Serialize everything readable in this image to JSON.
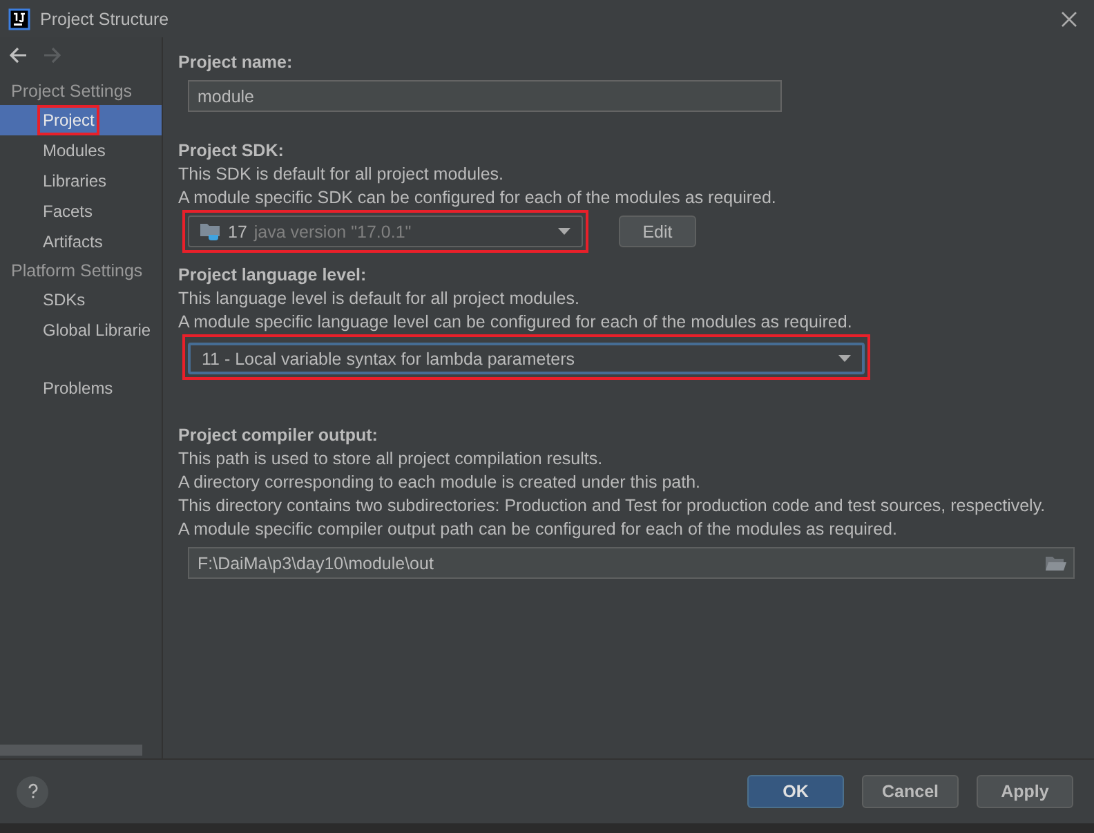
{
  "window": {
    "title": "Project Structure"
  },
  "navigation": [
    {
      "kind": "back",
      "disabled": false
    },
    {
      "kind": "forward",
      "disabled": true
    }
  ],
  "sidebar": {
    "groups": [
      {
        "title": "Project Settings",
        "items": [
          {
            "label": "Project",
            "selected": true,
            "highlighted": true
          },
          {
            "label": "Modules",
            "selected": false,
            "highlighted": false
          },
          {
            "label": "Libraries",
            "selected": false,
            "highlighted": false
          },
          {
            "label": "Facets",
            "selected": false,
            "highlighted": false
          },
          {
            "label": "Artifacts",
            "selected": false,
            "highlighted": false
          }
        ]
      },
      {
        "title": "Platform Settings",
        "items": [
          {
            "label": "SDKs",
            "selected": false,
            "highlighted": false
          },
          {
            "label": "Global Librarie",
            "selected": false,
            "highlighted": false
          }
        ]
      },
      {
        "items": [
          {
            "label": "Problems",
            "selected": false,
            "highlighted": false
          }
        ]
      }
    ]
  },
  "sections": [
    {
      "kind": "text",
      "label": "Project name:",
      "value": "module"
    },
    {
      "kind": "sdk",
      "label": "Project SDK:",
      "description": [
        "This SDK is default for all project modules.",
        "A module specific SDK can be configured for each of the modules as required."
      ],
      "version": "17",
      "detail": "java version \"17.0.1\"",
      "button": "Edit",
      "highlighted": true
    },
    {
      "kind": "combo",
      "label": "Project language level:",
      "description": [
        "This language level is default for all project modules.",
        "A module specific language level can be configured for each of the modules as required."
      ],
      "value": "11 - Local variable syntax for lambda parameters",
      "focused": true,
      "highlighted": true
    },
    {
      "kind": "path",
      "label": "Project compiler output:",
      "description": [
        "This path is used to store all project compilation results.",
        "A directory corresponding to each module is created under this path.",
        "This directory contains two subdirectories: Production and Test for production code and test sources, respectively.",
        "A module specific compiler output path can be configured for each of the modules as required."
      ],
      "value": "F:\\DaiMa\\p3\\day10\\module\\out"
    }
  ],
  "buttons": [
    {
      "label": "OK",
      "default": true
    },
    {
      "label": "Cancel",
      "default": false
    },
    {
      "label": "Apply",
      "default": false
    }
  ]
}
